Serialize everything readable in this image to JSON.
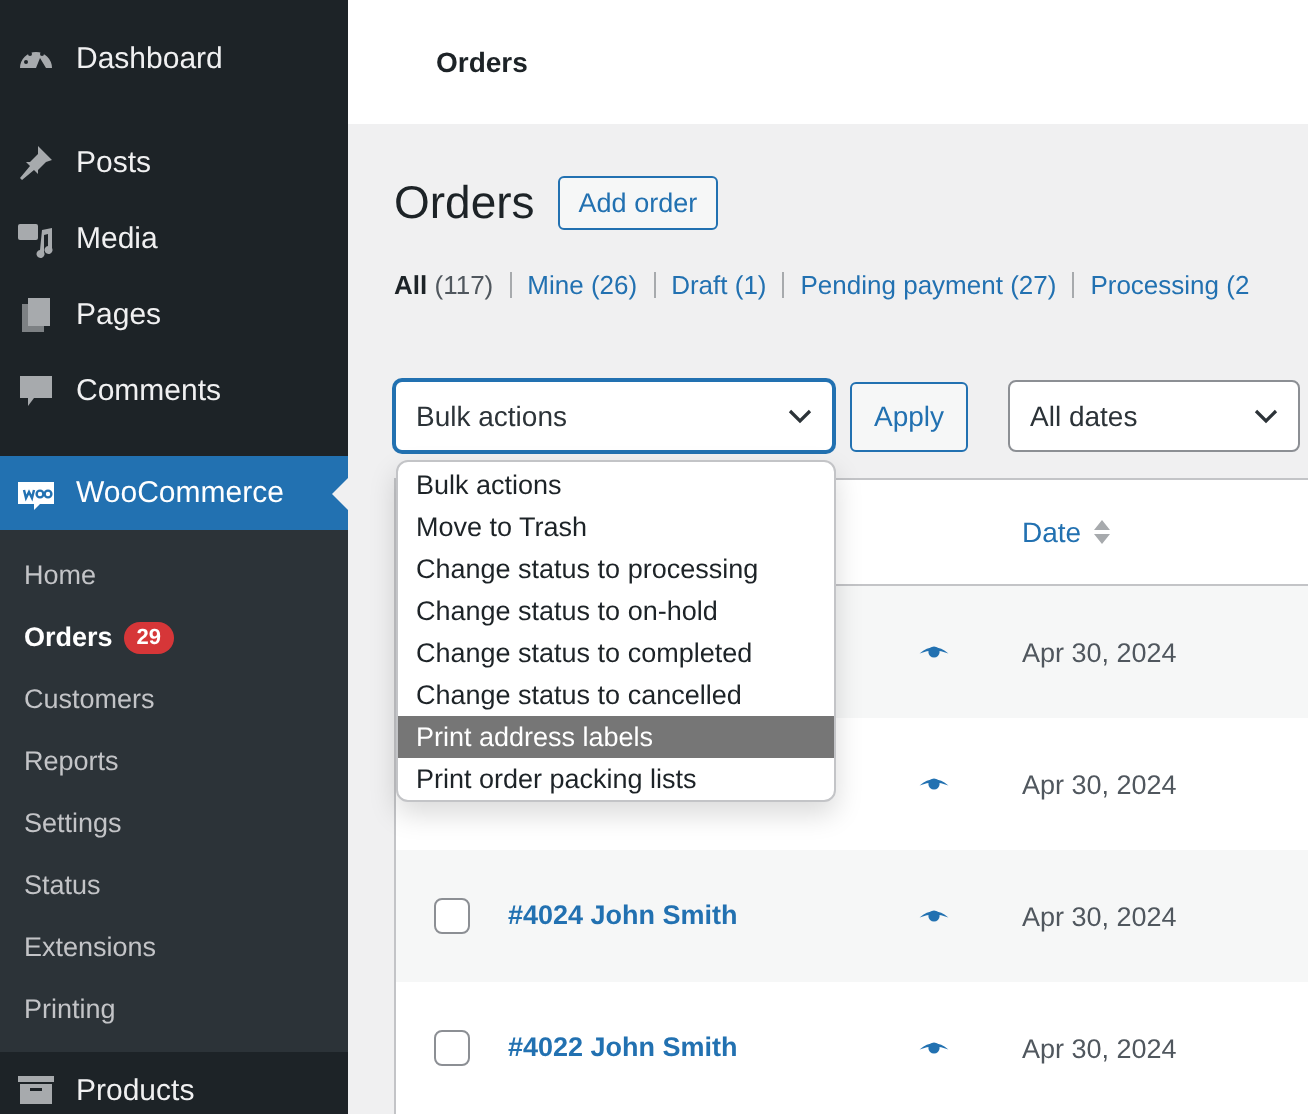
{
  "sidebar": {
    "items": [
      {
        "label": "Dashboard",
        "selected": false
      },
      {
        "label": "Posts",
        "selected": false
      },
      {
        "label": "Media",
        "selected": false
      },
      {
        "label": "Pages",
        "selected": false
      },
      {
        "label": "Comments",
        "selected": false
      },
      {
        "label": "WooCommerce",
        "selected": true,
        "children": [
          {
            "label": "Home",
            "selected": false
          },
          {
            "label": "Orders",
            "selected": true,
            "badge": "29"
          },
          {
            "label": "Customers",
            "selected": false
          },
          {
            "label": "Reports",
            "selected": false
          },
          {
            "label": "Settings",
            "selected": false
          },
          {
            "label": "Status",
            "selected": false
          },
          {
            "label": "Extensions",
            "selected": false
          },
          {
            "label": "Printing",
            "selected": false
          }
        ]
      },
      {
        "label": "Products",
        "selected": false
      }
    ]
  },
  "header": {
    "title": "Orders"
  },
  "page": {
    "title": "Orders",
    "add_button": "Add order"
  },
  "filters": [
    {
      "label": "All",
      "count": "(117)",
      "selected": true
    },
    {
      "label": "Mine",
      "count": "(26)",
      "selected": false
    },
    {
      "label": "Draft",
      "count": "(1)",
      "selected": false
    },
    {
      "label": "Pending payment",
      "count": "(27)",
      "selected": false
    },
    {
      "label": "Processing",
      "count": "(2",
      "selected": false
    }
  ],
  "bulk_actions": {
    "value": "Bulk actions",
    "apply": "Apply",
    "options": [
      {
        "label": "Bulk actions",
        "highlighted": false
      },
      {
        "label": "Move to Trash",
        "highlighted": false
      },
      {
        "label": "Change status to processing",
        "highlighted": false
      },
      {
        "label": "Change status to on-hold",
        "highlighted": false
      },
      {
        "label": "Change status to completed",
        "highlighted": false
      },
      {
        "label": "Change status to cancelled",
        "highlighted": false
      },
      {
        "label": "Print address labels",
        "highlighted": true
      },
      {
        "label": "Print order packing lists",
        "highlighted": false
      }
    ]
  },
  "date_filter": {
    "value": "All dates"
  },
  "table": {
    "columns": [
      {
        "label": "Date"
      }
    ],
    "rows": [
      {
        "date": "Apr 30, 2024"
      },
      {
        "date": "Apr 30, 2024"
      },
      {
        "order": "#4024 John Smith",
        "checked": false,
        "date": "Apr 30, 2024"
      },
      {
        "order": "#4022 John Smith",
        "checked": false,
        "date": "Apr 30, 2024"
      }
    ]
  }
}
